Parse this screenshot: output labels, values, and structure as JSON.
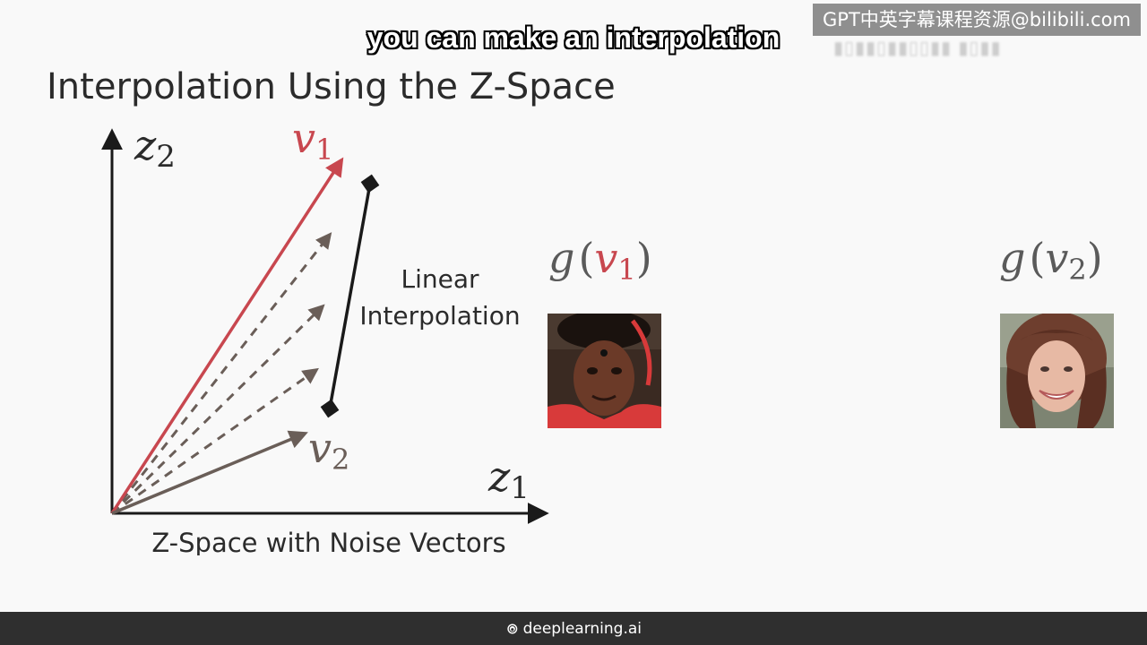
{
  "watermark": {
    "text": "GPT中英字幕课程资源@bilibili.com"
  },
  "subtitle": {
    "text": "you can make an interpolation"
  },
  "slide": {
    "title": "Interpolation Using the Z-Space",
    "diagram": {
      "axis_y_label_base": "z",
      "axis_y_label_sub": "2",
      "axis_x_label_base": "z",
      "axis_x_label_sub": "1",
      "vector1_label_base": "v",
      "vector1_label_sub": "1",
      "vector2_label_base": "v",
      "vector2_label_sub": "2",
      "interp_label_line1": "Linear",
      "interp_label_line2": "Interpolation",
      "caption": "Z-Space with Noise Vectors",
      "dashed_vector_count": 3
    },
    "outputs": [
      {
        "func": "g",
        "open": "(",
        "arg_base": "v",
        "arg_sub": "1",
        "close": ")"
      },
      {
        "func": "g",
        "open": "(",
        "arg_base": "v",
        "arg_sub": "2",
        "close": ")"
      }
    ]
  },
  "footer": {
    "brand": "deeplearning.ai"
  },
  "colors": {
    "vector1": "#c8474f",
    "vector2": "#6a5e58",
    "dashed": "#6a5e58",
    "axis": "#1a1a1a",
    "text": "#2b2b2b",
    "footer_bg": "#2f2f2f"
  }
}
